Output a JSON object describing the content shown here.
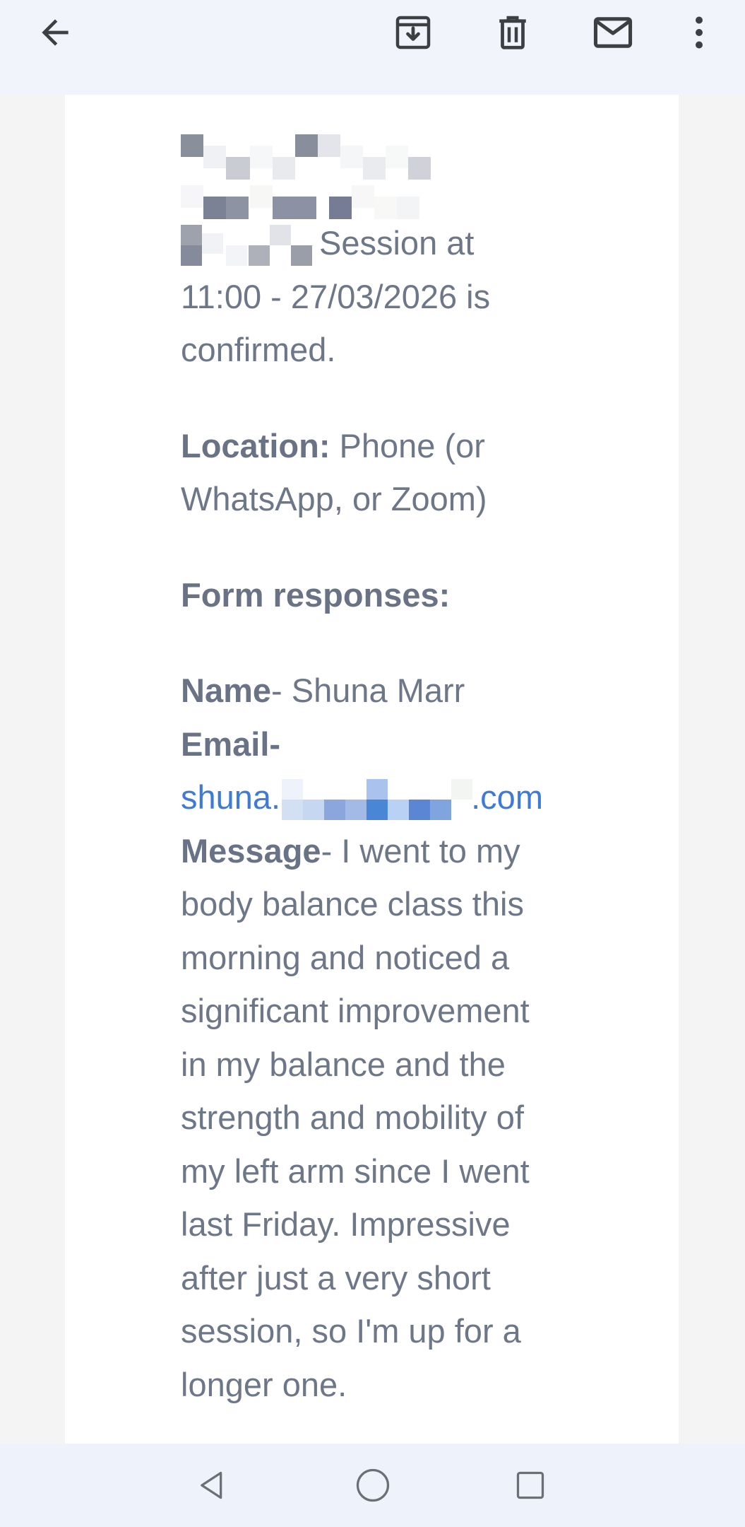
{
  "toolbar": {
    "icons": [
      "back-arrow-icon",
      "archive-icon",
      "delete-icon",
      "mark-unread-icon",
      "more-vert-icon"
    ],
    "icon_color": "#3c4043",
    "background": "#f1f4fa"
  },
  "email": {
    "intro_tail": "Session at",
    "intro_line2": "11:00 - 27/03/2026 is",
    "intro_line3": "confirmed.",
    "location_label": "Location:",
    "location_value_1": " Phone (or",
    "location_value_2": "WhatsApp, or Zoom)",
    "form_heading": "Form responses:",
    "name_label": "Name",
    "name_value": "- Shuna Marr",
    "email_label": "Email-",
    "email_prefix": "shuna.",
    "email_suffix": ".com",
    "message_label": "Message",
    "message_lines": [
      "- I went to my",
      "body balance class this",
      "morning and noticed a",
      "significant improvement",
      "in my balance and the",
      "strength and mobility of",
      "my left arm since I went",
      "last Friday. Impressive",
      "after just a very short",
      "session, so I'm up for a",
      "longer one."
    ],
    "text_color": "#6e7787",
    "link_color": "#3f7bd6"
  },
  "navbar": {
    "icons": [
      "nav-back-icon",
      "nav-home-icon",
      "nav-recents-icon"
    ],
    "background": "#eef2fa"
  }
}
